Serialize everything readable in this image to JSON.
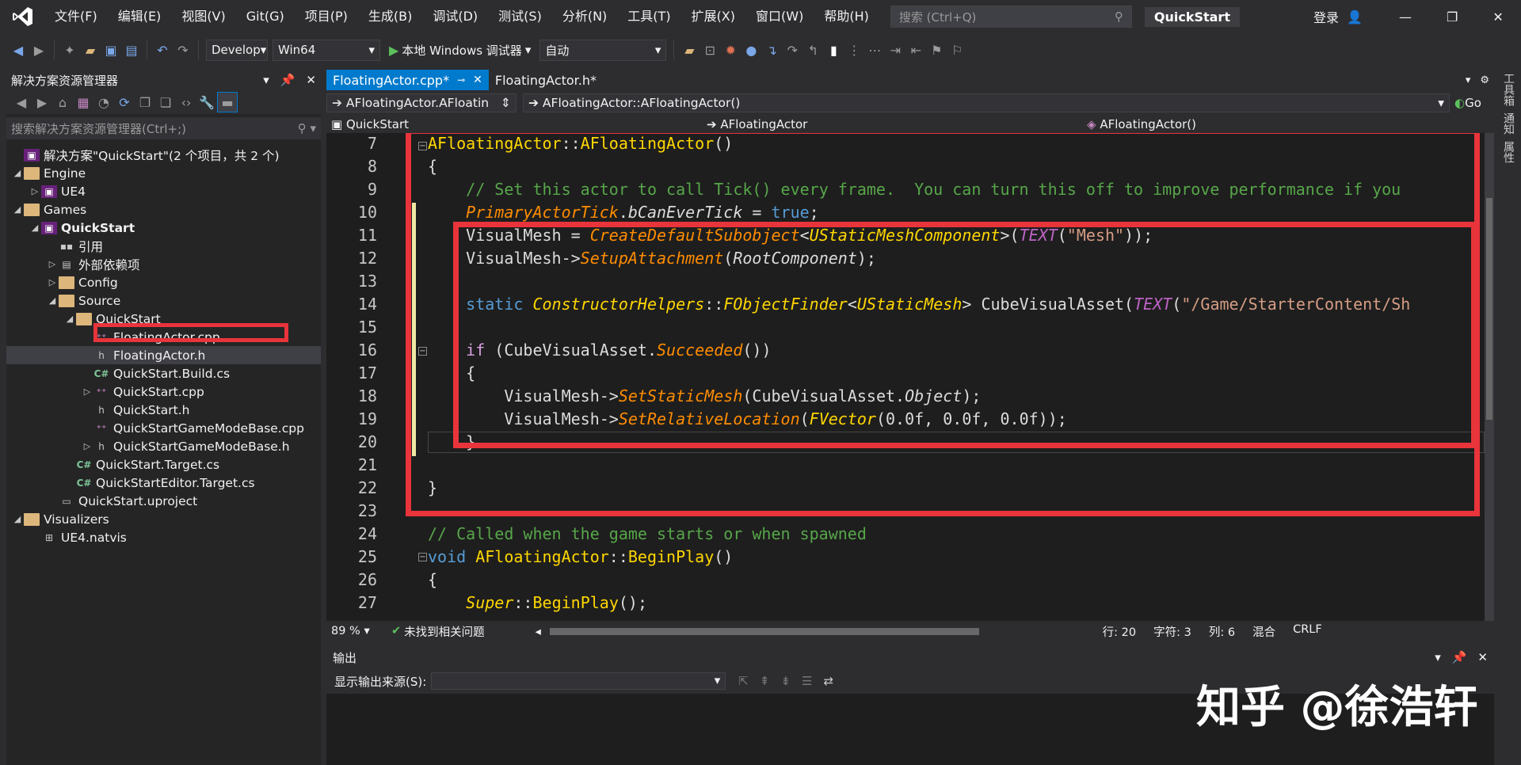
{
  "menubar": {
    "items": [
      "文件(F)",
      "编辑(E)",
      "视图(V)",
      "Git(G)",
      "项目(P)",
      "生成(B)",
      "调试(D)",
      "测试(S)",
      "分析(N)",
      "工具(T)",
      "扩展(X)",
      "窗口(W)",
      "帮助(H)"
    ],
    "search_placeholder": "搜索 (Ctrl+Q)",
    "project": "QuickStart",
    "login": "登录"
  },
  "toolbar": {
    "config": "Develop",
    "platform": "Win64",
    "debugger": "本地 Windows 调试器",
    "mode": "自动"
  },
  "solution_explorer": {
    "title": "解决方案资源管理器",
    "search_placeholder": "搜索解决方案资源管理器(Ctrl+;)",
    "tree": [
      {
        "label": "解决方案\"QuickStart\"(2 个项目，共 2 个)",
        "indent": 0,
        "arrow": "",
        "icon": "sln"
      },
      {
        "label": "Engine",
        "indent": 0,
        "arrow": "◢",
        "icon": "folder"
      },
      {
        "label": "UE4",
        "indent": 1,
        "arrow": "▷",
        "icon": "sln"
      },
      {
        "label": "Games",
        "indent": 0,
        "arrow": "◢",
        "icon": "folder"
      },
      {
        "label": "QuickStart",
        "indent": 1,
        "arrow": "◢",
        "icon": "sln",
        "bold": true
      },
      {
        "label": "引用",
        "indent": 2,
        "arrow": "",
        "icon": "ref"
      },
      {
        "label": "外部依赖项",
        "indent": 2,
        "arrow": "▷",
        "icon": "ext"
      },
      {
        "label": "Config",
        "indent": 2,
        "arrow": "▷",
        "icon": "folder"
      },
      {
        "label": "Source",
        "indent": 2,
        "arrow": "◢",
        "icon": "folder"
      },
      {
        "label": "QuickStart",
        "indent": 3,
        "arrow": "◢",
        "icon": "folder"
      },
      {
        "label": "FloatingActor.cpp",
        "indent": 4,
        "arrow": "",
        "icon": "cpp"
      },
      {
        "label": "FloatingActor.h",
        "indent": 4,
        "arrow": "",
        "icon": "h",
        "selected": true
      },
      {
        "label": "QuickStart.Build.cs",
        "indent": 4,
        "arrow": "",
        "icon": "cs"
      },
      {
        "label": "QuickStart.cpp",
        "indent": 4,
        "arrow": "▷",
        "icon": "cpp"
      },
      {
        "label": "QuickStart.h",
        "indent": 4,
        "arrow": "",
        "icon": "h"
      },
      {
        "label": "QuickStartGameModeBase.cpp",
        "indent": 4,
        "arrow": "",
        "icon": "cpp"
      },
      {
        "label": "QuickStartGameModeBase.h",
        "indent": 4,
        "arrow": "▷",
        "icon": "h"
      },
      {
        "label": "QuickStart.Target.cs",
        "indent": 3,
        "arrow": "",
        "icon": "cs"
      },
      {
        "label": "QuickStartEditor.Target.cs",
        "indent": 3,
        "arrow": "",
        "icon": "cs"
      },
      {
        "label": "QuickStart.uproject",
        "indent": 2,
        "arrow": "",
        "icon": "file"
      },
      {
        "label": "Visualizers",
        "indent": 0,
        "arrow": "◢",
        "icon": "folder"
      },
      {
        "label": "UE4.natvis",
        "indent": 1,
        "arrow": "",
        "icon": "natvis"
      }
    ]
  },
  "tabs": [
    {
      "label": "FloatingActor.cpp*",
      "active": true
    },
    {
      "label": "FloatingActor.h*",
      "active": false
    }
  ],
  "nav": {
    "scope": "AFloatingActor.AFloatin",
    "member": "AFloatingActor::AFloatingActor()",
    "go": "Go",
    "project": "QuickStart",
    "class": "AFloatingActor",
    "func": "AFloatingActor()"
  },
  "code_lines": [
    {
      "n": "7",
      "html": "<span class='bold-fn'>AFloatingActor</span>::<span class='bold-fn'>AFloatingActor</span>()"
    },
    {
      "n": "8",
      "html": "{"
    },
    {
      "n": "9",
      "html": "    <span class='cm'>// Set this actor to call Tick() every frame.  You can turn this off to improve performance if you</span>"
    },
    {
      "n": "10",
      "html": "    <span class='fn'>PrimaryActorTick</span>.<span class='mem'>bCanEverTick</span> = <span class='kw'>true</span>;"
    },
    {
      "n": "11",
      "html": "    VisualMesh = <span class='fn'>CreateDefaultSubobject</span>&lt;<span class='ty'>UStaticMeshComponent</span>&gt;(<span class='mac'>TEXT</span>(<span class='st'>\"Mesh\"</span>));"
    },
    {
      "n": "12",
      "html": "    VisualMesh-&gt;<span class='fn'>SetupAttachment</span>(<span class='mem'>RootComponent</span>);"
    },
    {
      "n": "13",
      "html": ""
    },
    {
      "n": "14",
      "html": "    <span class='kw'>static</span> <span class='ty'>ConstructorHelpers</span>::<span class='ty'>FObjectFinder</span>&lt;<span class='ty'>UStaticMesh</span>&gt; CubeVisualAsset(<span class='mac'>TEXT</span>(<span class='st'>\"/Game/StarterContent/Sh</span>"
    },
    {
      "n": "15",
      "html": ""
    },
    {
      "n": "16",
      "html": "    <span class='ctl'>if</span> (CubeVisualAsset.<span class='fn'>Succeeded</span>())"
    },
    {
      "n": "17",
      "html": "    {"
    },
    {
      "n": "18",
      "html": "        VisualMesh-&gt;<span class='fn'>SetStaticMesh</span>(CubeVisualAsset.<span class='mem'>Object</span>);"
    },
    {
      "n": "19",
      "html": "        VisualMesh-&gt;<span class='fn'>SetRelativeLocation</span>(<span class='ty'>FVector</span>(0.0f, 0.0f, 0.0f));"
    },
    {
      "n": "20",
      "html": "    }"
    },
    {
      "n": "21",
      "html": ""
    },
    {
      "n": "22",
      "html": "}"
    },
    {
      "n": "23",
      "html": ""
    },
    {
      "n": "24",
      "html": "<span class='cm'>// Called when the game starts or when spawned</span>"
    },
    {
      "n": "25",
      "html": "<span class='kw'>void</span> <span class='bold-fn'>AFloatingActor</span>::<span class='bold-fn'>BeginPlay</span>()"
    },
    {
      "n": "26",
      "html": "{"
    },
    {
      "n": "27",
      "html": "    <span class='ty'>Super</span>::<span class='bold-fn'>BeginPlay</span>();"
    }
  ],
  "status": {
    "zoom": "89 %",
    "issues": "未找到相关问题",
    "line": "行: 20",
    "char": "字符: 3",
    "col": "列: 6",
    "mix": "混合",
    "eol": "CRLF"
  },
  "output": {
    "title": "输出",
    "source_label": "显示输出来源(S):"
  },
  "right_tabs": [
    "工具箱",
    "通知",
    "属性"
  ],
  "watermark": "知乎 @徐浩轩"
}
